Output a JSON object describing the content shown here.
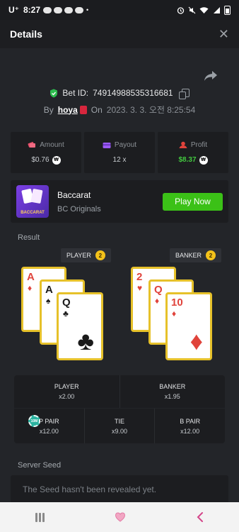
{
  "status_bar": {
    "carrier": "U⁺",
    "time": "8:27",
    "dot": "•"
  },
  "header": {
    "title": "Details",
    "close": "✕"
  },
  "bet": {
    "id_label": "Bet ID:",
    "id_value": "74914988535316681",
    "by_label": "By",
    "username": "hoya",
    "on_label": "On",
    "timestamp": "2023. 3. 3. 오전 8:25:54"
  },
  "stats": [
    {
      "label": "Amount",
      "value": "$0.76",
      "currency": "₩",
      "icon": "amount-icon",
      "color": "#e8506b"
    },
    {
      "label": "Payout",
      "value": "12 x",
      "currency": "",
      "icon": "payout-icon",
      "color": "#9b59f5"
    },
    {
      "label": "Profit",
      "value": "$8.37",
      "currency": "₩",
      "icon": "profit-icon",
      "color": "#e0433b"
    }
  ],
  "game": {
    "name": "Baccarat",
    "provider": "BC Originals",
    "thumb_label": "BACCARAT",
    "play_label": "Play Now"
  },
  "result": {
    "label": "Result",
    "player": {
      "label": "PLAYER",
      "score": "2"
    },
    "banker": {
      "label": "BANKER",
      "score": "2"
    },
    "player_cards": [
      {
        "rank": "A",
        "suit": "♦",
        "color": "red"
      },
      {
        "rank": "A",
        "suit": "♠",
        "color": "black"
      },
      {
        "rank": "Q",
        "suit": "♣",
        "color": "black"
      }
    ],
    "banker_cards": [
      {
        "rank": "2",
        "suit": "♥",
        "color": "red"
      },
      {
        "rank": "Q",
        "suit": "♦",
        "color": "red"
      },
      {
        "rank": "10",
        "suit": "♦",
        "color": "red"
      }
    ]
  },
  "bets": {
    "player": {
      "label": "PLAYER",
      "mult": "x2.00"
    },
    "banker": {
      "label": "BANKER",
      "mult": "x1.95"
    },
    "p_pair": {
      "label": "P PAIR",
      "mult": "x12.00",
      "chip": "10M"
    },
    "tie": {
      "label": "TIE",
      "mult": "x9.00"
    },
    "b_pair": {
      "label": "B PAIR",
      "mult": "x12.00"
    }
  },
  "seed": {
    "label": "Server Seed",
    "message": "The Seed hasn't been revealed yet."
  },
  "colors": {
    "accent_green": "#3bc117",
    "card_border": "#e6c12a",
    "background": "#232529"
  }
}
